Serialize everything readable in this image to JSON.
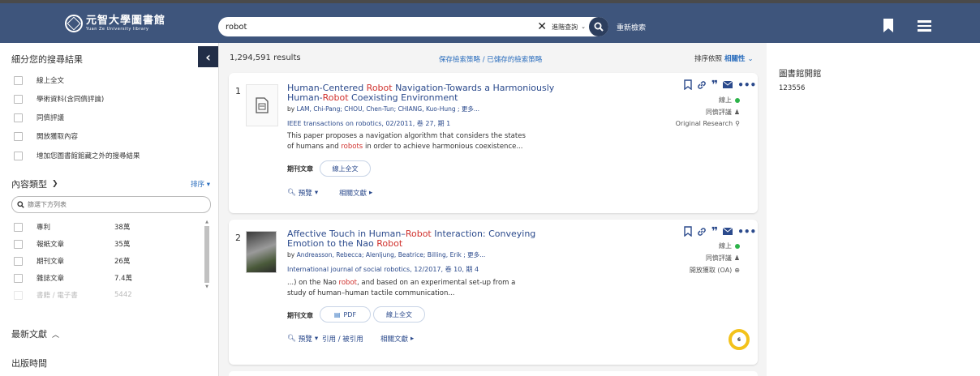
{
  "header": {
    "logo_cn": "元智大學圖書館",
    "logo_en": "Yuan Ze University library",
    "search": {
      "value": "robot",
      "scope": "進階查詢"
    },
    "reset": "重新檢索"
  },
  "sidebar": {
    "refine_title": "細分您的搜尋結果",
    "filters": [
      "線上全文",
      "學術資料(含同儕評論)",
      "同儕評議",
      "開放獲取內容",
      "增加您圖書館館藏之外的搜尋結果"
    ],
    "content_type": {
      "title": "內容類型",
      "sort": "排序",
      "filter_placeholder": "篩選下方列表",
      "items": [
        {
          "label": "專利",
          "count": "38萬"
        },
        {
          "label": "報紙文章",
          "count": "35萬"
        },
        {
          "label": "期刊文章",
          "count": "26萬"
        },
        {
          "label": "雜誌文章",
          "count": "7.4萬"
        },
        {
          "label": "書籍 / 電子書",
          "count": "5442"
        }
      ]
    },
    "latest": "最新文獻",
    "pub_time": "出版時間"
  },
  "results": {
    "count": "1,294,591 results",
    "save_strategy": "保存檢索策略 / 已儲存的檢索策略",
    "sort_label": "排序依照",
    "sort_value": "相關性",
    "items": [
      {
        "num": "1",
        "title_parts": [
          "Human-Centered ",
          "Robot",
          " Navigation-Towards a Harmoniously Human-",
          "Robot",
          " Coexisting Environment"
        ],
        "by": "by ",
        "authors": "LAM, Chi-Pang; CHOU, Chen-Tun; CHIANG, Kuo-Hung ; 更多...",
        "source": "IEEE transactions on robotics, 02/2011, 卷 27, 期 1",
        "snippet_parts": [
          "This paper proposes a navigation algorithm that considers the states of humans and ",
          "robots",
          " in order to achieve harmonious coexistence..."
        ],
        "type": "期刊文章",
        "fulltext": "線上全文",
        "preview": "預覽",
        "related": "相關文獻",
        "status": [
          "線上",
          "同儕評議",
          "Original Research"
        ]
      },
      {
        "num": "2",
        "title_parts": [
          "Affective Touch in Human–",
          "Robot",
          " Interaction: Conveying Emotion to the Nao ",
          "Robot",
          ""
        ],
        "by": "by ",
        "authors": "Andreasson, Rebecca; Alenljung, Beatrice; Billing, Erik ; 更多...",
        "source": "International journal of social robotics, 12/2017, 卷 10, 期 4",
        "snippet_parts": [
          "...) on the Nao ",
          "robot",
          ", and based on an experimental set-up from a study of human–human tactile communication..."
        ],
        "type": "期刊文章",
        "pdf": "PDF",
        "fulltext": "線上全文",
        "preview": "預覽",
        "cite": "引用 / 被引用",
        "related": "相關文獻",
        "status": [
          "線上",
          "同儕評議",
          "開放獲取 (OA)"
        ],
        "badge": "6"
      }
    ]
  },
  "right_panel": {
    "title": "圖書館開館",
    "value": "123556"
  },
  "colors": {
    "header": "#3e557c",
    "link": "#2b4a8c",
    "highlight": "#d0312d",
    "online": "#2db34a"
  }
}
